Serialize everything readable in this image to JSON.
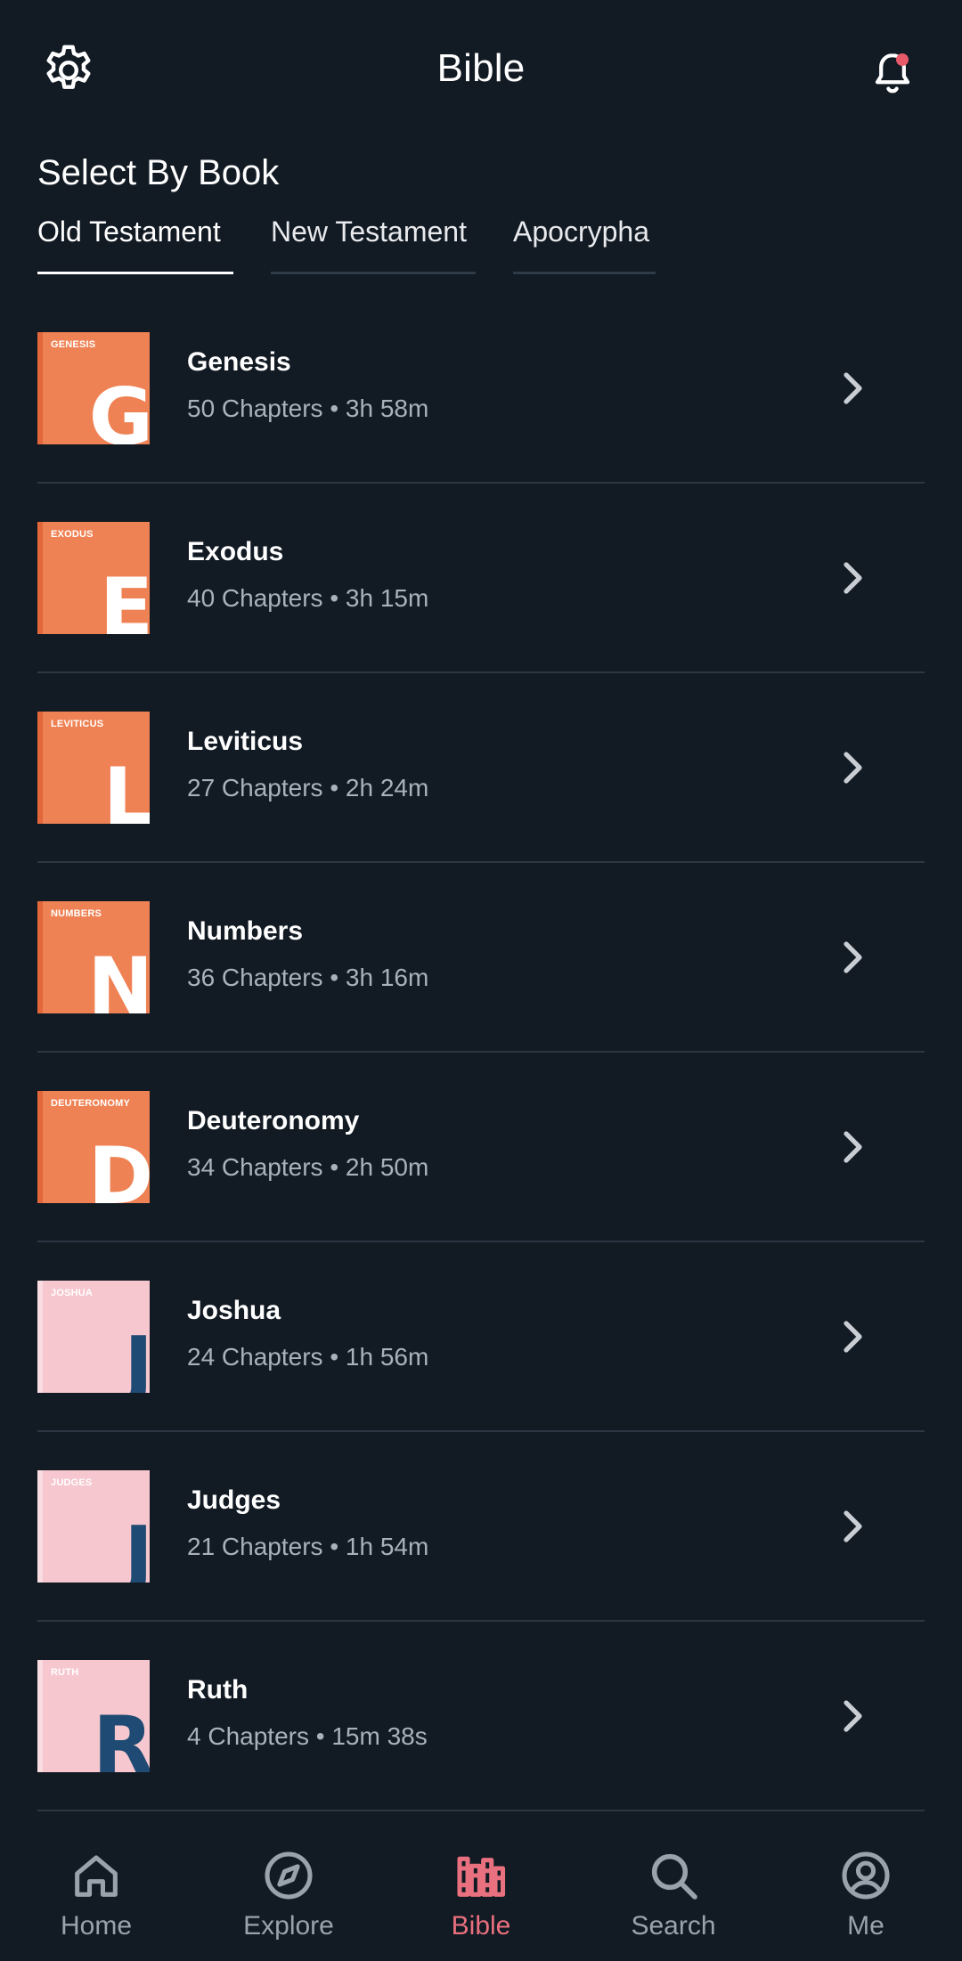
{
  "header": {
    "title": "Bible",
    "settings_icon": "gear-icon",
    "notifications_icon": "bell-icon",
    "notification_dot_color": "#e85a69"
  },
  "section_title": "Select By Book",
  "tabs": [
    {
      "label": "Old Testament",
      "active": true
    },
    {
      "label": "New Testament",
      "active": false
    },
    {
      "label": "Apocrypha",
      "active": false
    }
  ],
  "books": [
    {
      "name": "Genesis",
      "meta": "50 Chapters • 3h 58m",
      "cover_caption": "GENESIS",
      "cover_letter": "G",
      "cover_color": "orange"
    },
    {
      "name": "Exodus",
      "meta": "40 Chapters • 3h 15m",
      "cover_caption": "EXODUS",
      "cover_letter": "E",
      "cover_color": "orange"
    },
    {
      "name": "Leviticus",
      "meta": "27 Chapters • 2h 24m",
      "cover_caption": "LEVITICUS",
      "cover_letter": "L",
      "cover_color": "orange"
    },
    {
      "name": "Numbers",
      "meta": "36 Chapters • 3h 16m",
      "cover_caption": "NUMBERS",
      "cover_letter": "N",
      "cover_color": "orange"
    },
    {
      "name": "Deuteronomy",
      "meta": "34 Chapters • 2h 50m",
      "cover_caption": "DEUTERONOMY",
      "cover_letter": "D",
      "cover_color": "orange"
    },
    {
      "name": "Joshua",
      "meta": "24 Chapters • 1h 56m",
      "cover_caption": "JOSHUA",
      "cover_letter": "J",
      "cover_color": "pink"
    },
    {
      "name": "Judges",
      "meta": "21 Chapters • 1h 54m",
      "cover_caption": "JUDGES",
      "cover_letter": "J",
      "cover_color": "pink"
    },
    {
      "name": "Ruth",
      "meta": "4 Chapters • 15m 38s",
      "cover_caption": "RUTH",
      "cover_letter": "R",
      "cover_color": "pink"
    }
  ],
  "bottom_nav": [
    {
      "label": "Home",
      "icon": "home-icon",
      "active": false
    },
    {
      "label": "Explore",
      "icon": "compass-icon",
      "active": false
    },
    {
      "label": "Bible",
      "icon": "books-icon",
      "active": true
    },
    {
      "label": "Search",
      "icon": "search-icon",
      "active": false
    },
    {
      "label": "Me",
      "icon": "profile-icon",
      "active": false
    }
  ],
  "colors": {
    "background": "#121a23",
    "accent": "#e9707e",
    "cover_orange": "#ef8254",
    "cover_pink": "#f6c7cf"
  }
}
